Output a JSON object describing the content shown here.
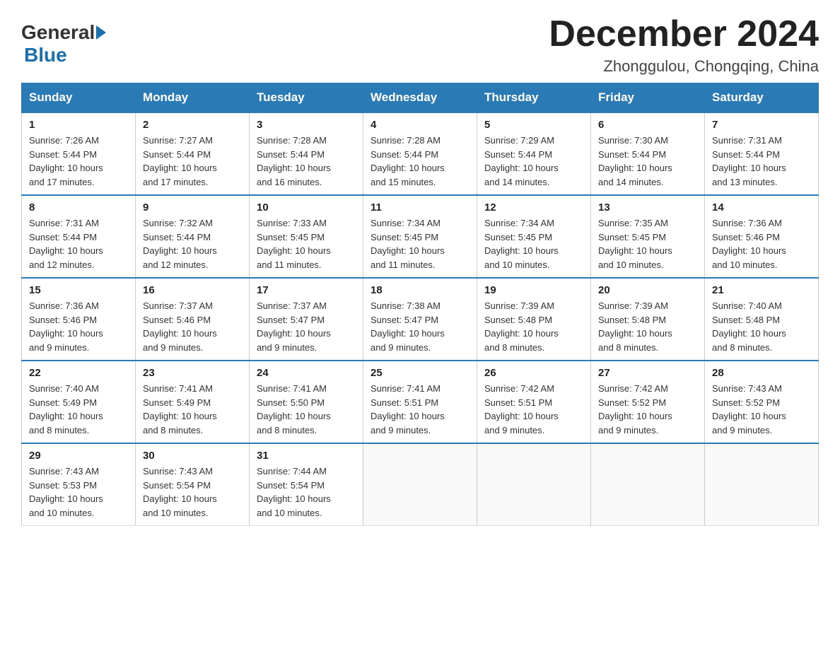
{
  "header": {
    "logo": {
      "general": "General",
      "blue": "Blue"
    },
    "title": "December 2024",
    "location": "Zhonggulou, Chongqing, China"
  },
  "calendar": {
    "days": [
      "Sunday",
      "Monday",
      "Tuesday",
      "Wednesday",
      "Thursday",
      "Friday",
      "Saturday"
    ],
    "weeks": [
      [
        {
          "num": "1",
          "info": "Sunrise: 7:26 AM\nSunset: 5:44 PM\nDaylight: 10 hours\nand 17 minutes."
        },
        {
          "num": "2",
          "info": "Sunrise: 7:27 AM\nSunset: 5:44 PM\nDaylight: 10 hours\nand 17 minutes."
        },
        {
          "num": "3",
          "info": "Sunrise: 7:28 AM\nSunset: 5:44 PM\nDaylight: 10 hours\nand 16 minutes."
        },
        {
          "num": "4",
          "info": "Sunrise: 7:28 AM\nSunset: 5:44 PM\nDaylight: 10 hours\nand 15 minutes."
        },
        {
          "num": "5",
          "info": "Sunrise: 7:29 AM\nSunset: 5:44 PM\nDaylight: 10 hours\nand 14 minutes."
        },
        {
          "num": "6",
          "info": "Sunrise: 7:30 AM\nSunset: 5:44 PM\nDaylight: 10 hours\nand 14 minutes."
        },
        {
          "num": "7",
          "info": "Sunrise: 7:31 AM\nSunset: 5:44 PM\nDaylight: 10 hours\nand 13 minutes."
        }
      ],
      [
        {
          "num": "8",
          "info": "Sunrise: 7:31 AM\nSunset: 5:44 PM\nDaylight: 10 hours\nand 12 minutes."
        },
        {
          "num": "9",
          "info": "Sunrise: 7:32 AM\nSunset: 5:44 PM\nDaylight: 10 hours\nand 12 minutes."
        },
        {
          "num": "10",
          "info": "Sunrise: 7:33 AM\nSunset: 5:45 PM\nDaylight: 10 hours\nand 11 minutes."
        },
        {
          "num": "11",
          "info": "Sunrise: 7:34 AM\nSunset: 5:45 PM\nDaylight: 10 hours\nand 11 minutes."
        },
        {
          "num": "12",
          "info": "Sunrise: 7:34 AM\nSunset: 5:45 PM\nDaylight: 10 hours\nand 10 minutes."
        },
        {
          "num": "13",
          "info": "Sunrise: 7:35 AM\nSunset: 5:45 PM\nDaylight: 10 hours\nand 10 minutes."
        },
        {
          "num": "14",
          "info": "Sunrise: 7:36 AM\nSunset: 5:46 PM\nDaylight: 10 hours\nand 10 minutes."
        }
      ],
      [
        {
          "num": "15",
          "info": "Sunrise: 7:36 AM\nSunset: 5:46 PM\nDaylight: 10 hours\nand 9 minutes."
        },
        {
          "num": "16",
          "info": "Sunrise: 7:37 AM\nSunset: 5:46 PM\nDaylight: 10 hours\nand 9 minutes."
        },
        {
          "num": "17",
          "info": "Sunrise: 7:37 AM\nSunset: 5:47 PM\nDaylight: 10 hours\nand 9 minutes."
        },
        {
          "num": "18",
          "info": "Sunrise: 7:38 AM\nSunset: 5:47 PM\nDaylight: 10 hours\nand 9 minutes."
        },
        {
          "num": "19",
          "info": "Sunrise: 7:39 AM\nSunset: 5:48 PM\nDaylight: 10 hours\nand 8 minutes."
        },
        {
          "num": "20",
          "info": "Sunrise: 7:39 AM\nSunset: 5:48 PM\nDaylight: 10 hours\nand 8 minutes."
        },
        {
          "num": "21",
          "info": "Sunrise: 7:40 AM\nSunset: 5:48 PM\nDaylight: 10 hours\nand 8 minutes."
        }
      ],
      [
        {
          "num": "22",
          "info": "Sunrise: 7:40 AM\nSunset: 5:49 PM\nDaylight: 10 hours\nand 8 minutes."
        },
        {
          "num": "23",
          "info": "Sunrise: 7:41 AM\nSunset: 5:49 PM\nDaylight: 10 hours\nand 8 minutes."
        },
        {
          "num": "24",
          "info": "Sunrise: 7:41 AM\nSunset: 5:50 PM\nDaylight: 10 hours\nand 8 minutes."
        },
        {
          "num": "25",
          "info": "Sunrise: 7:41 AM\nSunset: 5:51 PM\nDaylight: 10 hours\nand 9 minutes."
        },
        {
          "num": "26",
          "info": "Sunrise: 7:42 AM\nSunset: 5:51 PM\nDaylight: 10 hours\nand 9 minutes."
        },
        {
          "num": "27",
          "info": "Sunrise: 7:42 AM\nSunset: 5:52 PM\nDaylight: 10 hours\nand 9 minutes."
        },
        {
          "num": "28",
          "info": "Sunrise: 7:43 AM\nSunset: 5:52 PM\nDaylight: 10 hours\nand 9 minutes."
        }
      ],
      [
        {
          "num": "29",
          "info": "Sunrise: 7:43 AM\nSunset: 5:53 PM\nDaylight: 10 hours\nand 10 minutes."
        },
        {
          "num": "30",
          "info": "Sunrise: 7:43 AM\nSunset: 5:54 PM\nDaylight: 10 hours\nand 10 minutes."
        },
        {
          "num": "31",
          "info": "Sunrise: 7:44 AM\nSunset: 5:54 PM\nDaylight: 10 hours\nand 10 minutes."
        },
        null,
        null,
        null,
        null
      ]
    ]
  }
}
